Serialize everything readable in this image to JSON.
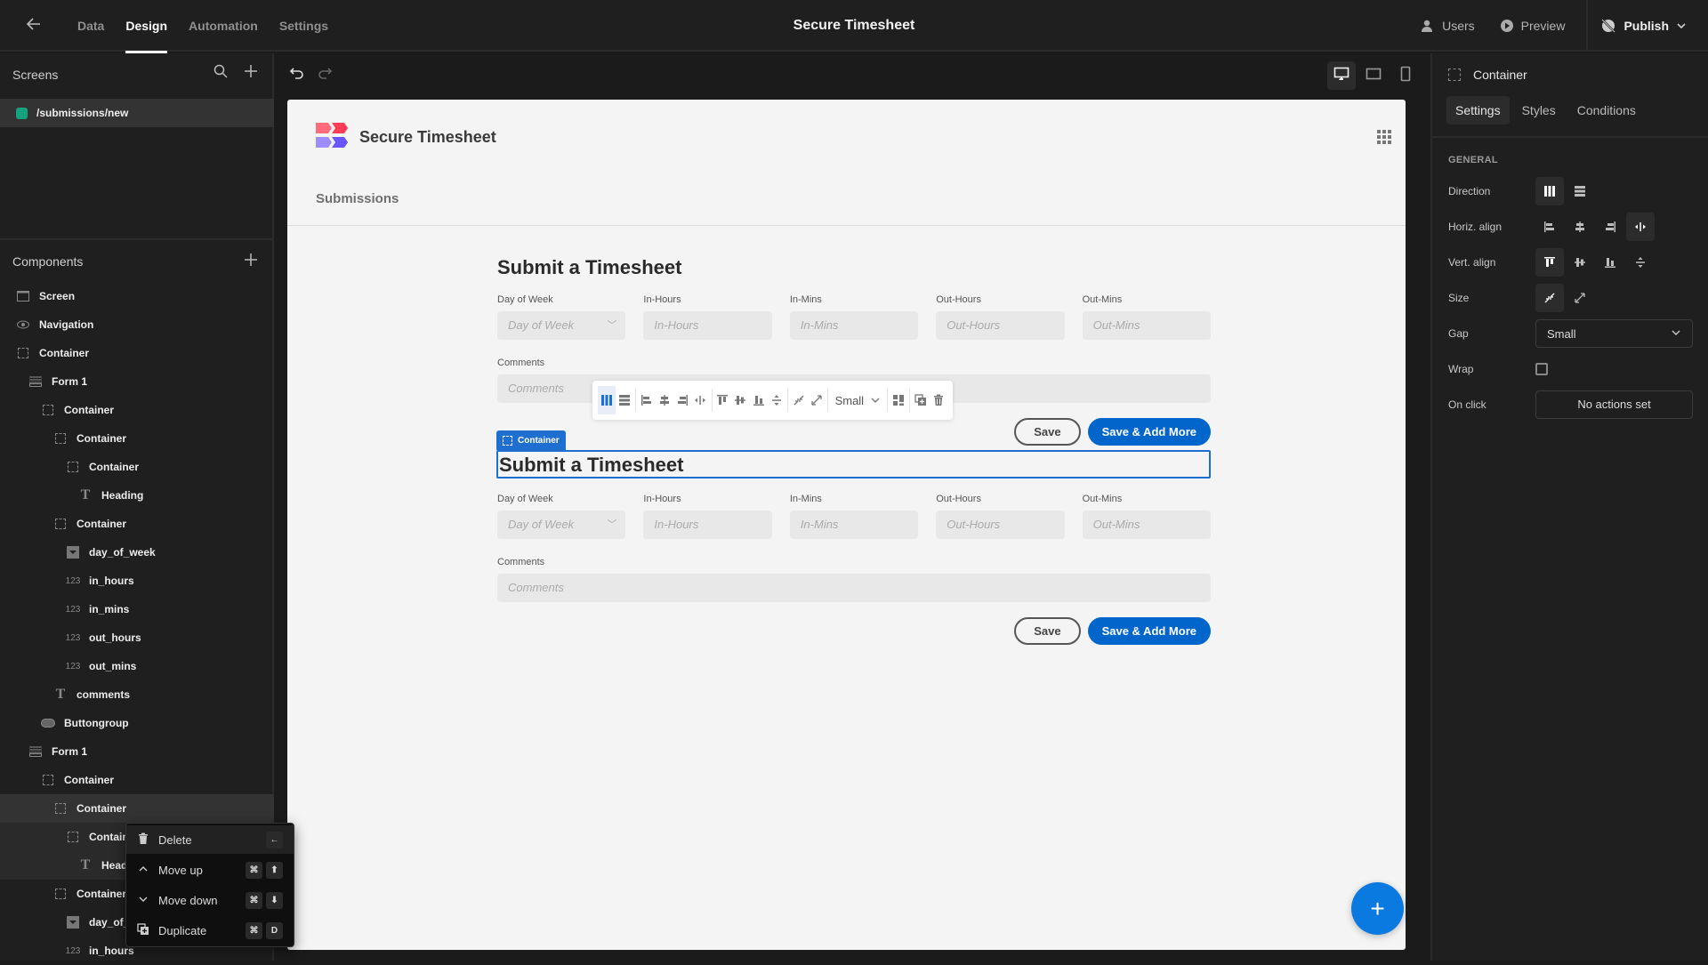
{
  "topbar": {
    "tabs": [
      {
        "label": "Data",
        "active": false
      },
      {
        "label": "Design",
        "active": true
      },
      {
        "label": "Automation",
        "active": false
      },
      {
        "label": "Settings",
        "active": false
      }
    ],
    "app_title": "Secure Timesheet",
    "users_label": "Users",
    "preview_label": "Preview",
    "publish_label": "Publish"
  },
  "screens": {
    "header": "Screens",
    "items": [
      {
        "label": "/submissions/new",
        "color": "#14a37f"
      }
    ]
  },
  "components": {
    "header": "Components",
    "tree": [
      {
        "label": "Screen",
        "icon": "screen-icon",
        "depth": 0
      },
      {
        "label": "Navigation",
        "icon": "eye-icon",
        "depth": 0
      },
      {
        "label": "Container",
        "icon": "container-icon",
        "depth": 0
      },
      {
        "label": "Form 1",
        "icon": "form-icon",
        "depth": 1
      },
      {
        "label": "Container",
        "icon": "container-icon",
        "depth": 2
      },
      {
        "label": "Container",
        "icon": "container-icon",
        "depth": 3
      },
      {
        "label": "Container",
        "icon": "container-icon",
        "depth": 4
      },
      {
        "label": "Heading",
        "icon": "text-icon",
        "depth": 5
      },
      {
        "label": "Container",
        "icon": "container-icon",
        "depth": 3
      },
      {
        "label": "day_of_week",
        "icon": "dropdown-icon",
        "depth": 4
      },
      {
        "label": "in_hours",
        "icon": "number-icon",
        "depth": 4
      },
      {
        "label": "in_mins",
        "icon": "number-icon",
        "depth": 4
      },
      {
        "label": "out_hours",
        "icon": "number-icon",
        "depth": 4
      },
      {
        "label": "out_mins",
        "icon": "number-icon",
        "depth": 4
      },
      {
        "label": "comments",
        "icon": "text-icon",
        "depth": 3
      },
      {
        "label": "Buttongroup",
        "icon": "button-icon",
        "depth": 2
      },
      {
        "label": "Form 1",
        "icon": "form-icon",
        "depth": 1
      },
      {
        "label": "Container",
        "icon": "container-icon",
        "depth": 2
      },
      {
        "label": "Container",
        "icon": "container-icon",
        "depth": 3,
        "selected": true
      },
      {
        "label": "Container",
        "icon": "container-icon",
        "depth": 4,
        "highlight": true
      },
      {
        "label": "Heading",
        "icon": "text-icon",
        "depth": 5,
        "highlight": true
      },
      {
        "label": "Container",
        "icon": "container-icon",
        "depth": 3
      },
      {
        "label": "day_of_week",
        "icon": "dropdown-icon",
        "depth": 4
      },
      {
        "label": "in_hours",
        "icon": "number-icon",
        "depth": 4
      }
    ]
  },
  "context_menu": {
    "items": [
      {
        "label": "Delete",
        "icon": "trash-icon",
        "keys": [
          "←"
        ]
      },
      {
        "label": "Move up",
        "icon": "chevron-up-icon",
        "keys": [
          "⌘",
          "⬆"
        ]
      },
      {
        "label": "Move down",
        "icon": "chevron-down-icon",
        "keys": [
          "⌘",
          "⬇"
        ]
      },
      {
        "label": "Duplicate",
        "icon": "duplicate-icon",
        "keys": [
          "⌘",
          "D"
        ]
      }
    ]
  },
  "canvas": {
    "brand": "Secure Timesheet",
    "nav_link": "Submissions",
    "forms": [
      {
        "title": "Submit a Timesheet",
        "fields": [
          {
            "label": "Day of Week",
            "placeholder": "Day of Week",
            "type": "select"
          },
          {
            "label": "In-Hours",
            "placeholder": "In-Hours"
          },
          {
            "label": "In-Mins",
            "placeholder": "In-Mins"
          },
          {
            "label": "Out-Hours",
            "placeholder": "Out-Hours"
          },
          {
            "label": "Out-Mins",
            "placeholder": "Out-Mins"
          }
        ],
        "comments_label": "Comments",
        "comments_placeholder": "Comments",
        "save": "Save",
        "save_more": "Save & Add More"
      },
      {
        "title": "Submit a Timesheet",
        "fields": [
          {
            "label": "Day of Week",
            "placeholder": "Day of Week",
            "type": "select"
          },
          {
            "label": "In-Hours",
            "placeholder": "In-Hours"
          },
          {
            "label": "In-Mins",
            "placeholder": "In-Mins"
          },
          {
            "label": "Out-Hours",
            "placeholder": "Out-Hours"
          },
          {
            "label": "Out-Mins",
            "placeholder": "Out-Mins"
          }
        ],
        "comments_label": "Comments",
        "comments_placeholder": "Comments",
        "save": "Save",
        "save_more": "Save & Add More"
      }
    ],
    "selection_tag": "Container",
    "toolbar_gap": "Small"
  },
  "properties": {
    "component": "Container",
    "tabs": [
      {
        "label": "Settings",
        "active": true
      },
      {
        "label": "Styles",
        "active": false
      },
      {
        "label": "Conditions",
        "active": false
      }
    ],
    "section": "GENERAL",
    "direction_label": "Direction",
    "direction_value": "columns",
    "horiz_label": "Horiz. align",
    "horiz_value": "stretch",
    "vert_label": "Vert. align",
    "vert_value": "top",
    "size_label": "Size",
    "size_value": "shrink",
    "gap_label": "Gap",
    "gap_value": "Small",
    "wrap_label": "Wrap",
    "wrap_checked": false,
    "onclick_label": "On click",
    "onclick_value": "No actions set"
  }
}
